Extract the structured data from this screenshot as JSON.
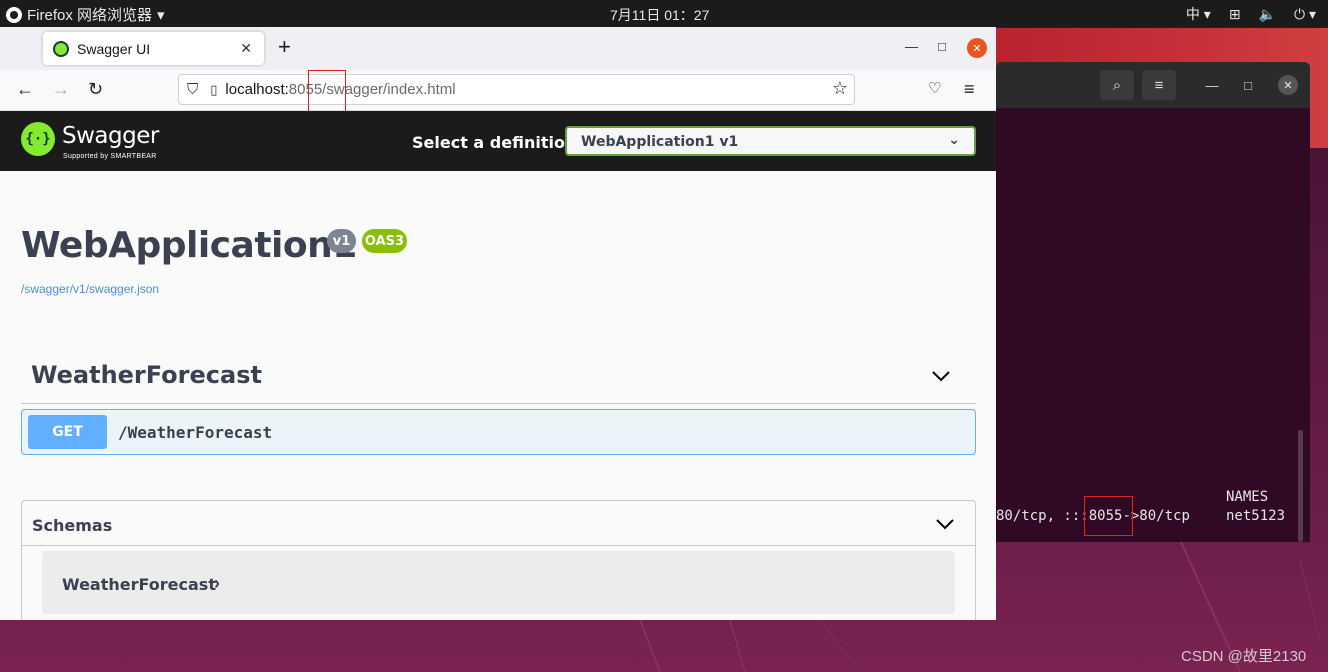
{
  "topbar": {
    "app_name": "Firefox 网络浏览器",
    "clock": "7月11日  01：27",
    "input_method": "中"
  },
  "browser": {
    "tab_title": "Swagger UI",
    "url": {
      "host": "localhost:",
      "port": "8055",
      "path": "/swagger/index.html"
    }
  },
  "swagger": {
    "brand": "Swagger",
    "brand_sub": "Supported by SMARTBEAR",
    "select_label": "Select a definition",
    "selected_definition": "WebApplication1 v1",
    "title": "WebApplication1",
    "version_badge": "v1",
    "oas_badge": "OAS3",
    "spec_link": "/swagger/v1/swagger.json",
    "tag": "WeatherForecast",
    "operation": {
      "method": "GET",
      "path": "/WeatherForecast"
    },
    "schemas_title": "Schemas",
    "schema_model": "WeatherForecast"
  },
  "terminal": {
    "names_header": "NAMES",
    "ports_prefix": "80/tcp, :::",
    "ports_port": "8055",
    "ports_suffix": "->80/tcp",
    "container_name": "net5123"
  },
  "watermark": "CSDN @故里2130",
  "colors": {
    "swagger_green": "#85ea2d",
    "get_blue": "#61affe",
    "ubuntu_orange": "#e95420",
    "highlight_red": "#e02020"
  }
}
